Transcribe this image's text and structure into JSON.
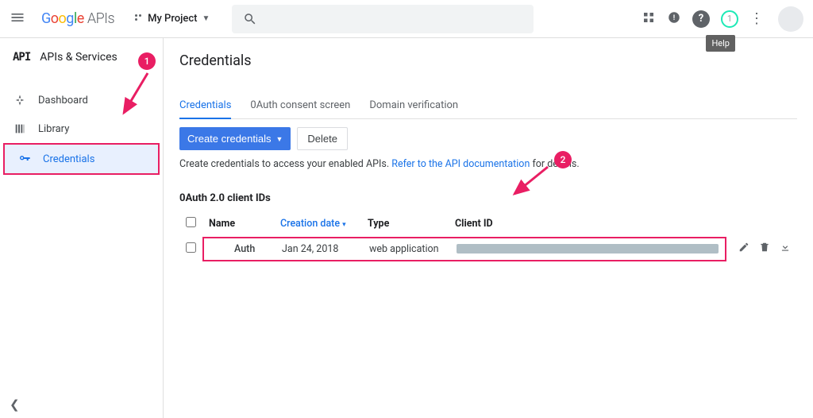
{
  "header": {
    "logo_apis": "APIs",
    "project_name": "My Project",
    "help_tooltip": "Help"
  },
  "sidebar": {
    "title": "APIs & Services",
    "logo_text": "API",
    "items": [
      {
        "label": "Dashboard"
      },
      {
        "label": "Library"
      },
      {
        "label": "Credentials"
      }
    ]
  },
  "page": {
    "title": "Credentials",
    "tabs": [
      {
        "label": "Credentials"
      },
      {
        "label": "0Auth consent screen"
      },
      {
        "label": "Domain verification"
      }
    ],
    "create_button": "Create credentials",
    "delete_button": "Delete",
    "hint_prefix": "Create credentials to access your enabled APIs. ",
    "hint_link": "Refer to the API documentation",
    "hint_suffix": " for details."
  },
  "oauth": {
    "section_title": "0Auth 2.0 client IDs",
    "columns": {
      "name": "Name",
      "created": "Creation date",
      "type": "Type",
      "client_id": "Client ID"
    },
    "rows": [
      {
        "name": "Auth",
        "created": "Jan 24, 2018",
        "type": "web application"
      }
    ]
  },
  "annotations": {
    "n1": "1",
    "n2": "2"
  }
}
